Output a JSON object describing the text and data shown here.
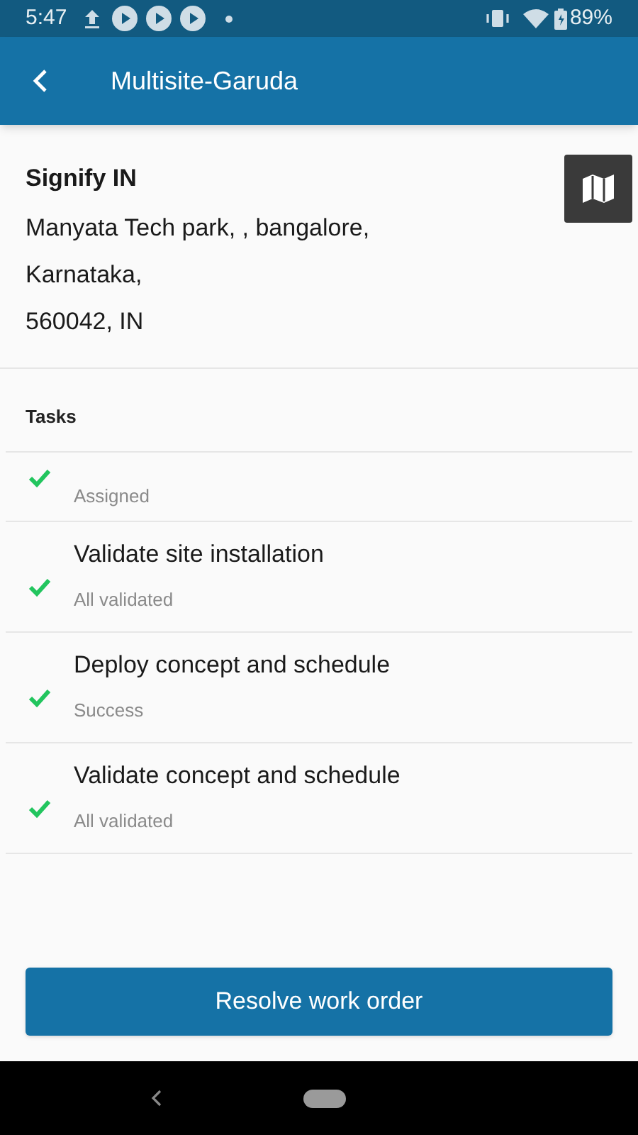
{
  "status_bar": {
    "time": "5:47",
    "battery": "89%"
  },
  "app_bar": {
    "title": "Multisite-Garuda"
  },
  "site": {
    "name": "Signify IN",
    "address_lines": [
      "Manyata Tech park, , bangalore,",
      "Karnataka,",
      "560042, IN"
    ]
  },
  "tasks": {
    "heading": "Tasks",
    "items": [
      {
        "status": "Assigned",
        "done": true
      },
      {
        "title": "Validate site installation",
        "status": "All validated",
        "done": true
      },
      {
        "title": "Deploy concept and schedule",
        "status": "Success",
        "done": true
      },
      {
        "title": "Validate concept and schedule",
        "status": "All validated",
        "done": true
      }
    ]
  },
  "primary_button": "Resolve work order"
}
